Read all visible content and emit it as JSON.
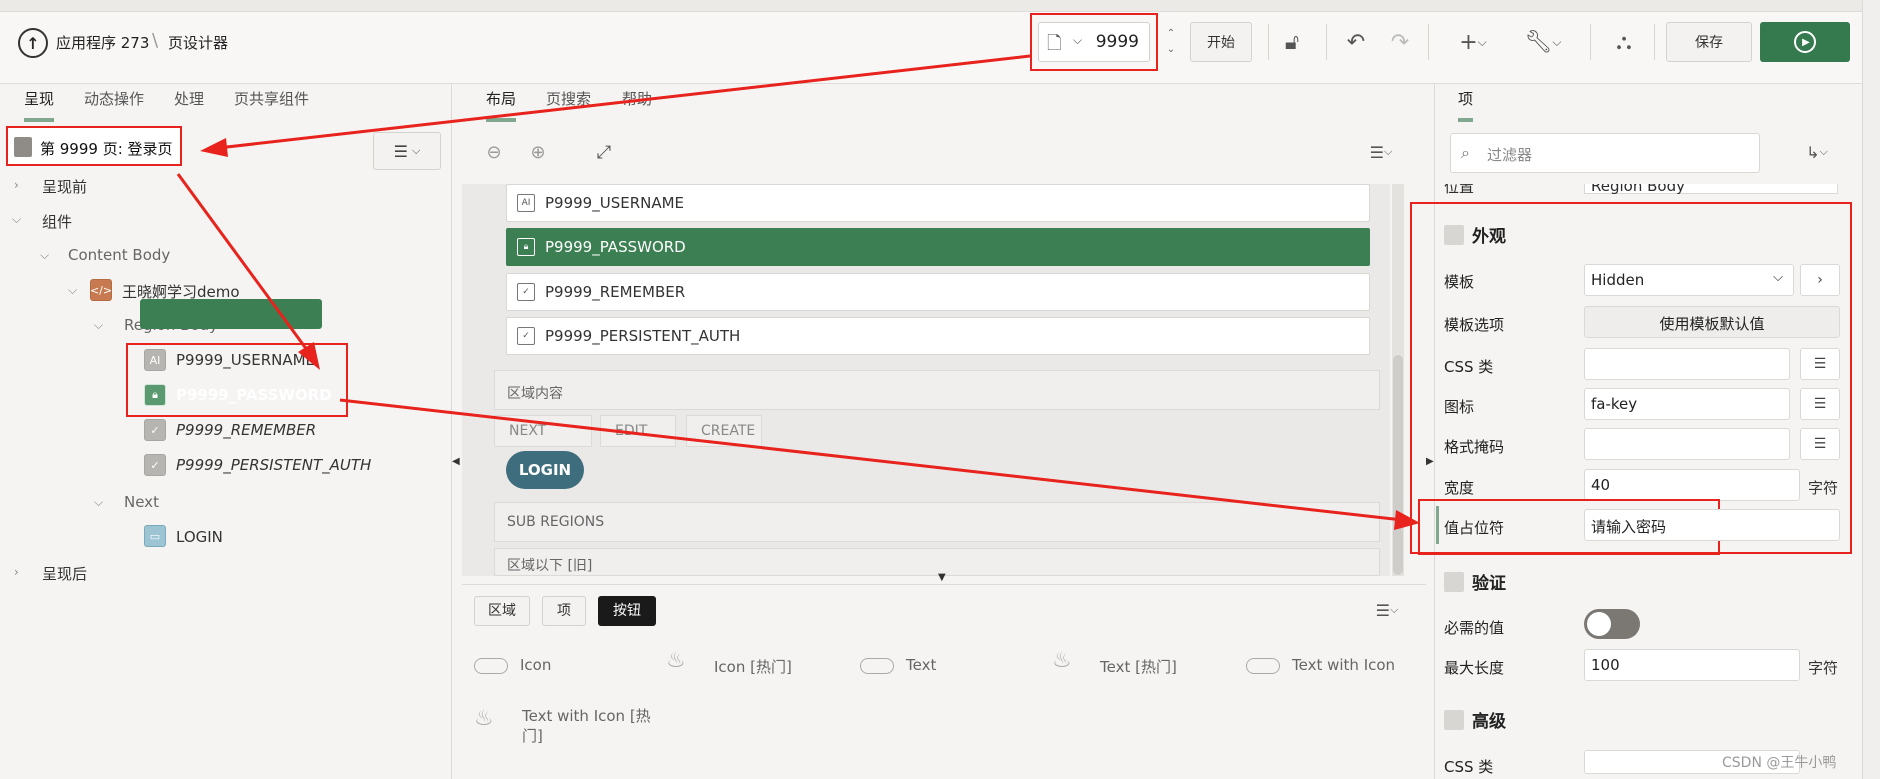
{
  "header": {
    "app_label": "应用程序 273",
    "page_designer": "页设计器",
    "page_number": "9999",
    "start_label": "开始",
    "save_label": "保存",
    "add_icon": "plus-icon",
    "tools_icon": "wrench-icon"
  },
  "left": {
    "tabs": [
      "呈现",
      "动态操作",
      "处理",
      "页共享组件"
    ],
    "page_title": "第 9999 页: 登录页",
    "tree": {
      "before": "呈现前",
      "components": "组件",
      "content_body": "Content Body",
      "region": "王晓婀学习demo",
      "region_body": "Region Body",
      "items": [
        "P9999_USERNAME",
        "P9999_PASSWORD",
        "P9999_REMEMBER",
        "P9999_PERSISTENT_AUTH"
      ],
      "next": "Next",
      "login": "LOGIN",
      "after": "呈现后"
    }
  },
  "center": {
    "tabs": [
      "布局",
      "页搜索",
      "帮助"
    ],
    "rows": [
      "P9999_USERNAME",
      "P9999_PASSWORD",
      "P9999_REMEMBER",
      "P9999_PERSISTENT_AUTH"
    ],
    "region_content": "区域内容",
    "buttons": [
      "NEXT",
      "EDIT",
      "CREATE"
    ],
    "login": "LOGIN",
    "sub_regions": "SUB REGIONS",
    "below_region": "区域以下 [旧]",
    "gallery_tabs": [
      "区域",
      "项",
      "按钮"
    ],
    "gallery_items": [
      "Icon",
      "Icon [热门]",
      "Text",
      "Text [热门]",
      "Text with Icon",
      "Text with Icon [热门]"
    ]
  },
  "right": {
    "tab": "项",
    "filter_placeholder": "过滤器",
    "position_label": "位置",
    "position_value": "Region Body",
    "appearance": "外观",
    "template_label": "模板",
    "template_value": "Hidden",
    "template_options_label": "模板选项",
    "template_options_value": "使用模板默认值",
    "css_label": "CSS 类",
    "icon_label": "图标",
    "icon_value": "fa-key",
    "format_mask_label": "格式掩码",
    "width_label": "宽度",
    "width_value": "40",
    "unit": "字符",
    "placeholder_label": "值占位符",
    "placeholder_value": "请输入密码",
    "validation": "验证",
    "required_label": "必需的值",
    "maxlen_label": "最大长度",
    "maxlen_value": "100",
    "advanced": "高级",
    "css2_label": "CSS 类"
  },
  "watermark": "CSDN @王牛小鸭"
}
